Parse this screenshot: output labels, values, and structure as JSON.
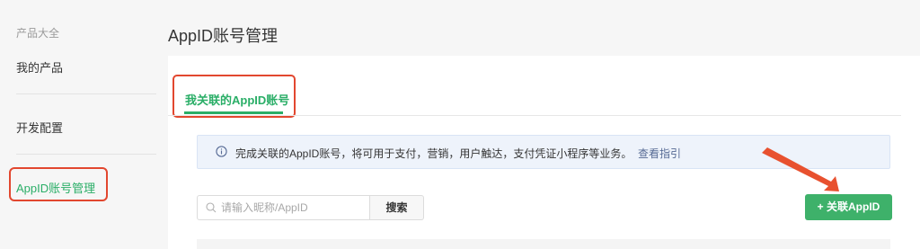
{
  "sidebar": {
    "category": "产品大全",
    "items": [
      {
        "label": "我的产品"
      },
      {
        "label": "开发配置"
      },
      {
        "label": "AppID账号管理"
      }
    ]
  },
  "page": {
    "title": "AppID账号管理"
  },
  "tabs": [
    {
      "label": "我关联的AppID账号",
      "active": true
    }
  ],
  "notice": {
    "text": "完成关联的AppID账号，将可用于支付，营销，用户触达，支付凭证小程序等业务。",
    "link": "查看指引",
    "icon": "info-icon"
  },
  "search": {
    "placeholder": "请输入昵称/AppID",
    "button": "搜索",
    "icon": "search-icon"
  },
  "actions": {
    "add_label": "+ 关联AppID"
  },
  "colors": {
    "accent_green": "#2aae67",
    "button_green": "#3eb16a",
    "highlight_red": "#e2472f",
    "link_blue": "#576b95"
  }
}
